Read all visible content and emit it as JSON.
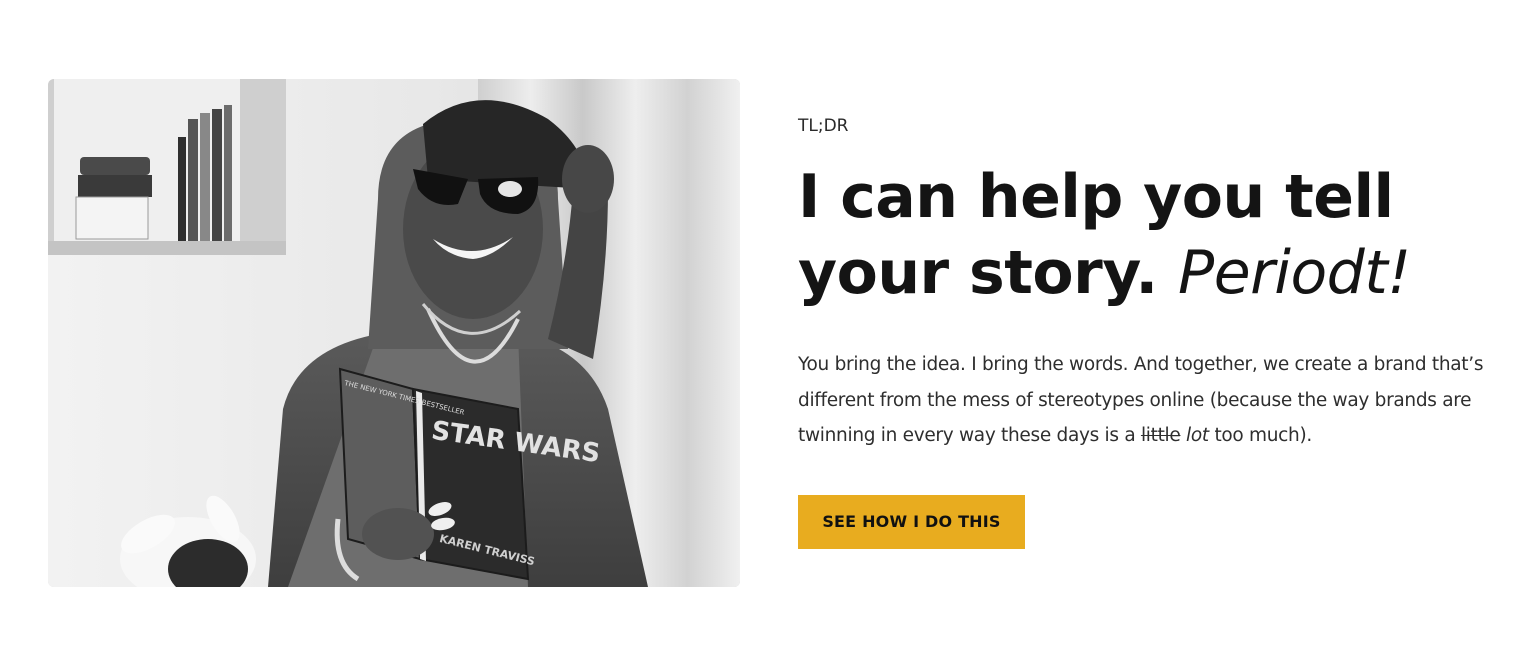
{
  "photo": {
    "image_alt": "Woman in sunglasses and cap holding a Star Wars book",
    "book_title": "STAR WARS",
    "book_author": "KAREN TRAVISS",
    "book_banner": "THE NEW YORK TIMES BESTSELLER"
  },
  "section": {
    "eyebrow": "TL;DR",
    "headline_main": "I can help you tell your story.",
    "headline_accent": "Periodt!",
    "body_part1": "You bring the idea. I bring the words. And together, we create a brand that’s different from the mess of stereotypes online (because the way brands are twinning in every way these days is a ",
    "body_struck": "little",
    "body_accent": "lot",
    "body_part2": " too much).",
    "cta_label": "SEE HOW I DO THIS"
  },
  "colors": {
    "cta_background": "#e8ac1f",
    "text": "#141414",
    "background": "#ffffff"
  }
}
